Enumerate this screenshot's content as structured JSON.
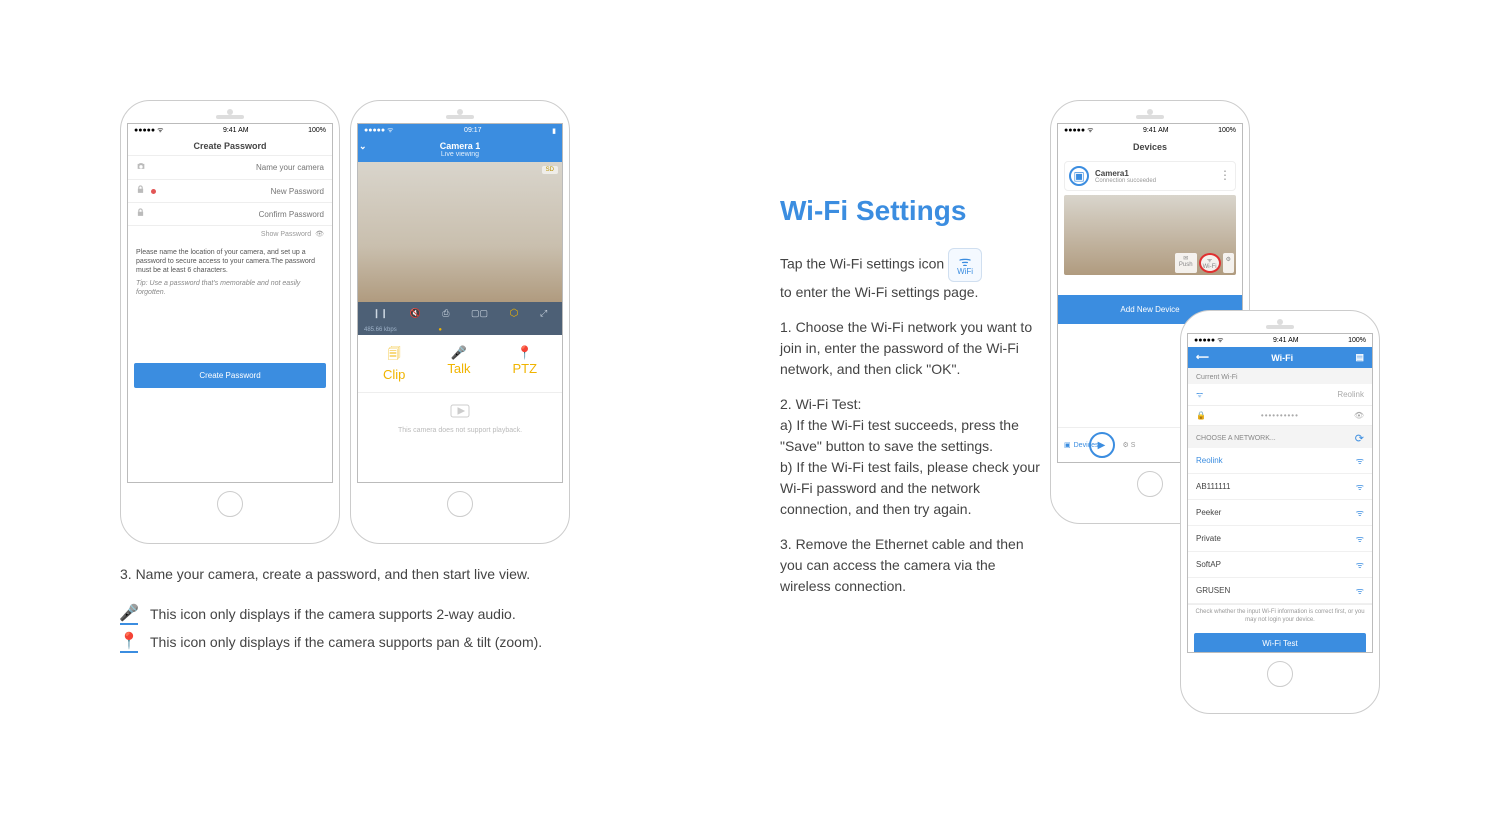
{
  "left": {
    "step3": "3. Name your camera, create a password, and then start live view.",
    "note_audio": "This icon only displays if the camera supports 2-way audio.",
    "note_ptz": "This icon only displays if the camera supports pan & tilt (zoom).",
    "phone_password": {
      "time": "9:41 AM",
      "battery": "100%",
      "title": "Create Password",
      "name_placeholder": "Name your camera",
      "new_pw_placeholder": "New Password",
      "confirm_pw_placeholder": "Confirm Password",
      "show_pw": "Show Password",
      "instr1": "Please name the location of your camera, and set up a password to secure access to your camera.The password must be at least 6 characters.",
      "tip": "Tip: Use a password that's memorable and not easily forgotten.",
      "button": "Create Password"
    },
    "phone_live": {
      "time": "09:17",
      "title": "Camera 1",
      "subtitle": "Live viewing",
      "sd": "SD",
      "kbps": "485.66 kbps",
      "clip": "Clip",
      "talk": "Talk",
      "ptz": "PTZ",
      "empty": "This camera does not support playback."
    }
  },
  "right": {
    "heading": "Wi-Fi Settings",
    "intro_a": "Tap the Wi-Fi settings icon",
    "wifi_chip": "WiFi",
    "intro_b": "to enter the Wi-Fi settings page.",
    "p1": "1. Choose the Wi-Fi network you want to join in, enter the password of the Wi-Fi network, and then click \"OK\".",
    "p2a": "2. Wi-Fi Test:",
    "p2b": "a) If the Wi-Fi test succeeds, press the \"Save\" button to save the settings.",
    "p2c": "b) If the Wi-Fi test fails, please check your Wi-Fi password and the network connection, and then try again.",
    "p3": "3. Remove the Ethernet cable and then you can access the camera via the wireless connection.",
    "phone_devices": {
      "time": "9:41 AM",
      "battery": "100%",
      "title": "Devices",
      "cam_name": "Camera1",
      "cam_status": "Connection succeeded",
      "pill_push": "Push",
      "pill_wifi": "Wi-Fi",
      "add_btn": "Add New Device",
      "nav_devices": "Devices"
    },
    "phone_wifi": {
      "time": "9:41 AM",
      "battery": "100%",
      "title": "Wi-Fi",
      "current_label": "Current Wi-Fi",
      "current_net": "Reolink",
      "masked": "••••••••••",
      "choose_label": "CHOOSE A NETWORK...",
      "networks": [
        "Reolink",
        "AB111111",
        "Peeker",
        "Private",
        "SoftAP",
        "GRUSEN"
      ],
      "footnote": "Check whether the input Wi-Fi information is correct first, or you may not login your device.",
      "button": "Wi-Fi Test"
    }
  }
}
